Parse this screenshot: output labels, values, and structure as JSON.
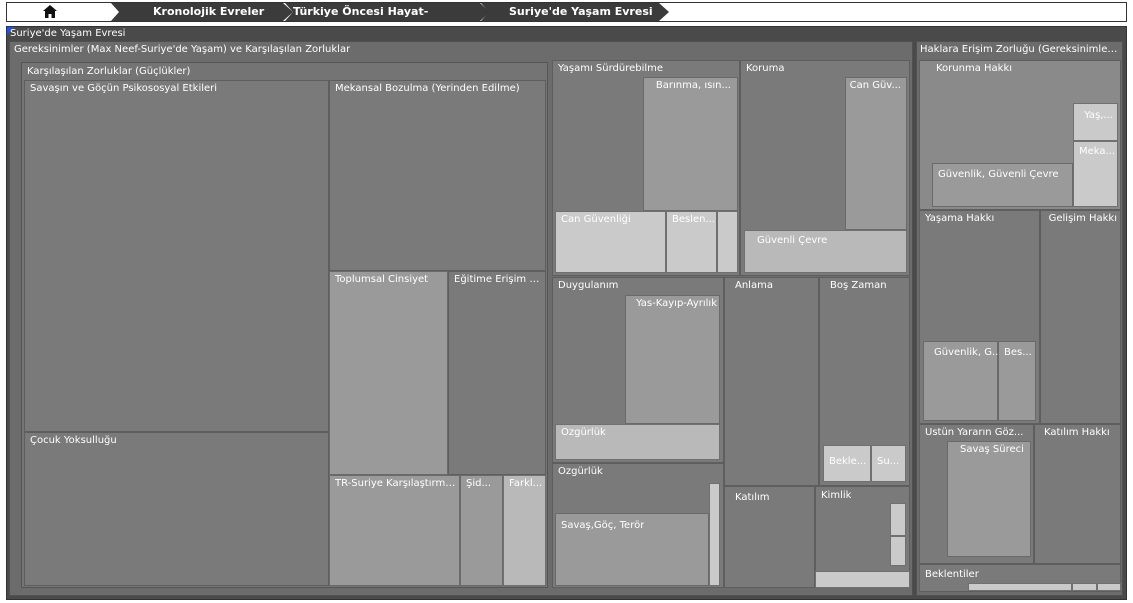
{
  "breadcrumb": {
    "home_icon": "home-icon",
    "items": [
      "Kronolojik Evreler",
      "Türkiye Öncesi Hayat-Türkiye'ye ...",
      "Suriye'de Yaşam Evresi"
    ]
  },
  "panel": {
    "title": "Suriye'de Yaşam Evresi"
  },
  "treemap": {
    "left": {
      "title": "Gereksinimler (Max Neef-Suriye'de Yaşam) ve Karşılaşılan Zorluklar",
      "zorluklar": {
        "title": "Karşılaşılan Zorluklar (Güçlükler)",
        "cells": {
          "psikososyal": "Savaşın ve Göçün Psikososyal Etkileri",
          "cocuk": "Çocuk Yoksulluğu",
          "mekansal": "Mekansal Bozulma (Yerinden Edilme)",
          "cinsiyet": "Toplumsal Cinsiyet",
          "egitim": "Eğitime Erişim S...",
          "tr_suriye": "TR-Suriye Karşılaştırma...",
          "sid": "Şid...",
          "farkl": "Farkl..."
        }
      },
      "yasami": {
        "title": "Yaşamı Sürdürebilme",
        "barinma": "Barınma, ısın...",
        "can": "Can Güvenliği",
        "beslen": "Beslen..."
      },
      "koruma": {
        "title": "Koruma",
        "can_guv": "Can Güv...",
        "guvenli": "Güvenli Çevre"
      },
      "duygulanim": {
        "title": "Duygulanım",
        "yas": "Yas-Kayıp-Ayrılık",
        "ozgurluk": "Özgürlük"
      },
      "anlama": {
        "title": "Anlama"
      },
      "bos_zaman": {
        "title": "Boş Zaman",
        "bekle": "Bekle...",
        "su": "Su..."
      },
      "ozgurluk2": {
        "title": "Özgürlük",
        "savas": "Savaş,Göç, Terör"
      },
      "katilim": {
        "title": "Katılım"
      },
      "kimlik": {
        "title": "Kimlik"
      }
    },
    "right": {
      "title": "Haklara Erişim Zorluğu (Gereksinimler ...",
      "korunma": {
        "title": "Korunma Hakkı",
        "yas": "Yaş,...",
        "meka": "Meka...",
        "guvenlik": "Güvenlik, Güvenli Çevre"
      },
      "yasama": {
        "title": "Yaşama Hakkı",
        "guvenlik": "Güvenlik, G...",
        "bes": "Bes..."
      },
      "gelisim": {
        "title": "Gelişim Hakkı"
      },
      "ustun": {
        "title": "Üstün Yararın Göz...",
        "savas": "Savaş Süreci"
      },
      "katilim": {
        "title": "Katılım Hakkı"
      },
      "beklentiler": {
        "title": "Beklentiler"
      }
    }
  }
}
